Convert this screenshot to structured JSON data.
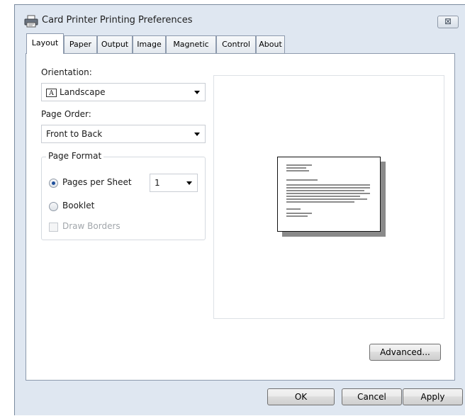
{
  "window": {
    "title": "Card Printer Printing Preferences",
    "close_label": "⊠"
  },
  "tabs": [
    {
      "label": "Layout",
      "active": true
    },
    {
      "label": "Paper"
    },
    {
      "label": "Output"
    },
    {
      "label": "Image"
    },
    {
      "label": "Magnetic"
    },
    {
      "label": "Control"
    },
    {
      "label": "About"
    }
  ],
  "layout": {
    "orientation": {
      "label": "Orientation:",
      "value": "Landscape",
      "icon_glyph": "A"
    },
    "page_order": {
      "label": "Page Order:",
      "value": "Front to Back"
    },
    "page_format": {
      "title": "Page Format",
      "pages_per_sheet": {
        "label": "Pages per Sheet",
        "checked": true,
        "value": "1"
      },
      "booklet": {
        "label": "Booklet",
        "checked": false
      },
      "draw_borders": {
        "label": "Draw Borders",
        "checked": false,
        "enabled": false
      }
    },
    "advanced_label": "Advanced..."
  },
  "footer": {
    "ok_label": "OK",
    "cancel_label": "Cancel",
    "apply_label": "Apply"
  },
  "colors": {
    "window_bg": "#dfe7f1",
    "radio_accent": "#1e4f9c"
  }
}
